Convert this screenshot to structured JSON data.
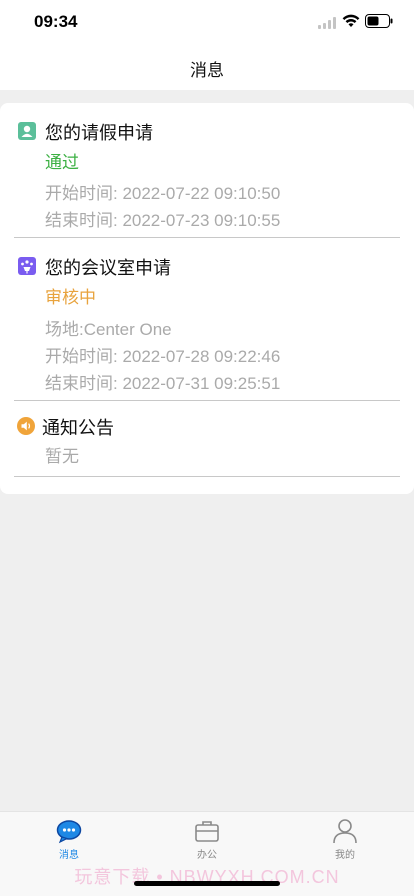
{
  "status_bar": {
    "time": "09:34"
  },
  "nav": {
    "title": "消息"
  },
  "sections": {
    "leave": {
      "title": "您的请假申请",
      "status": "通过",
      "status_color": "#3cb043",
      "lines": [
        "开始时间: 2022-07-22 09:10:50",
        "结束时间: 2022-07-23 09:10:55"
      ],
      "icon": "person-badge-icon"
    },
    "meeting": {
      "title": "您的会议室申请",
      "status": "审核中",
      "status_color": "#e8a33d",
      "lines": [
        "场地:Center One",
        "开始时间: 2022-07-28 09:22:46",
        "结束时间: 2022-07-31 09:25:51"
      ],
      "icon": "meeting-room-icon"
    },
    "notice": {
      "title": "通知公告",
      "content": "暂无",
      "icon": "speaker-icon"
    }
  },
  "tabs": [
    {
      "label": "消息",
      "icon": "chat-bubble-icon",
      "active": true
    },
    {
      "label": "办公",
      "icon": "briefcase-icon",
      "active": false
    },
    {
      "label": "我的",
      "icon": "person-icon",
      "active": false
    }
  ],
  "watermark": "玩意下载 • NBWYXH.COM.CN",
  "colors": {
    "accent": "#1e88e5",
    "leave_icon": "#5bbf9a",
    "meeting_icon": "#7a5cf0",
    "notice_icon": "#f0a43a"
  }
}
